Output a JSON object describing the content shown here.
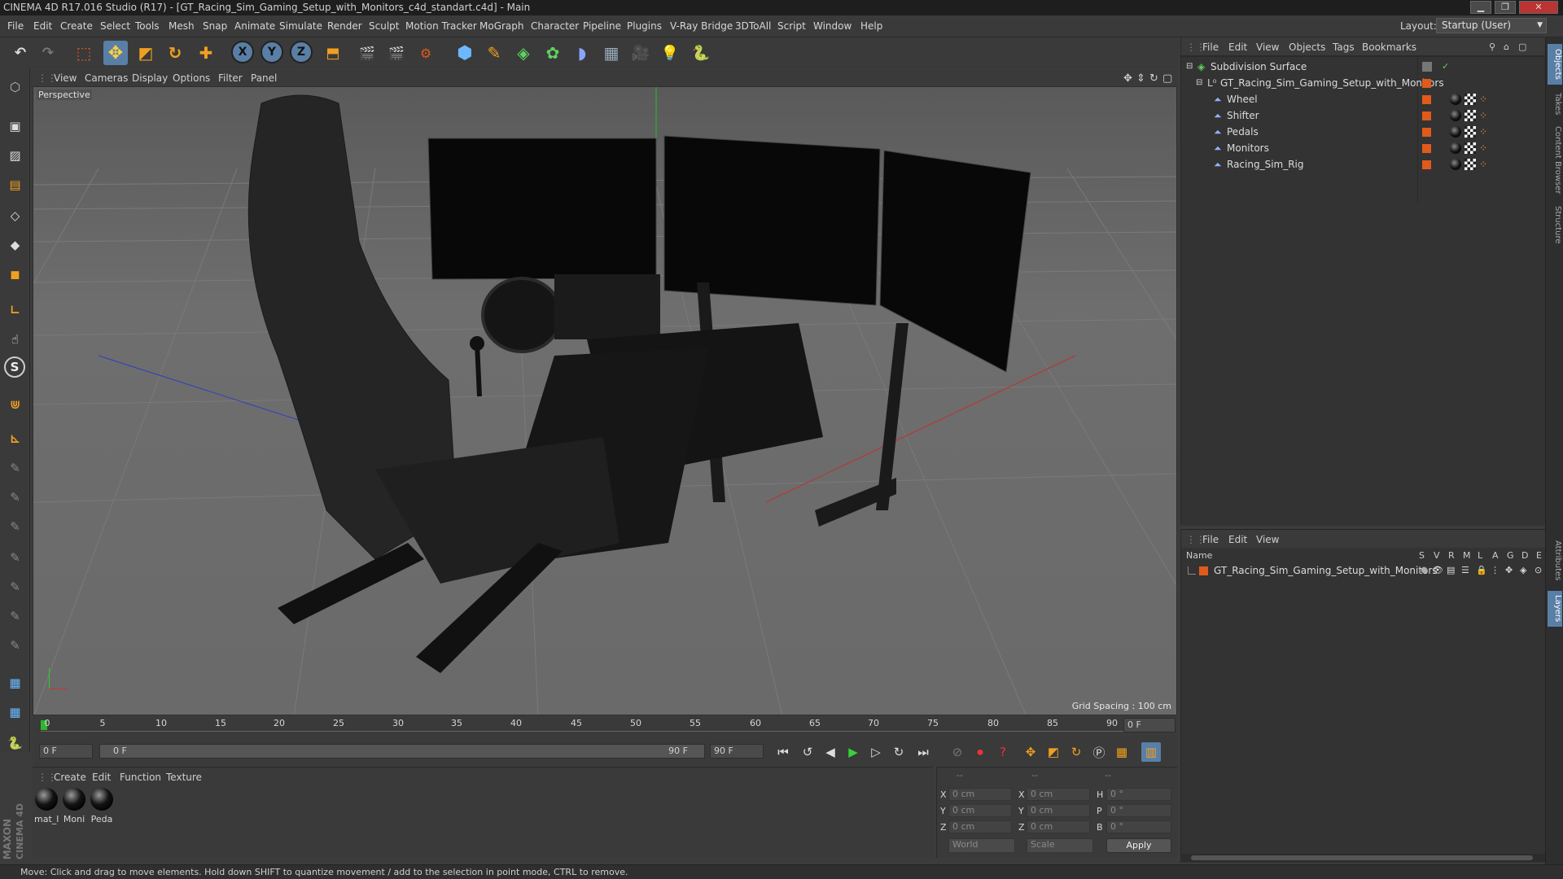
{
  "app_title": "CINEMA 4D R17.016 Studio (R17) - [GT_Racing_Sim_Gaming_Setup_with_Monitors_c4d_standart.c4d] - Main",
  "menu": [
    "File",
    "Edit",
    "Create",
    "Select",
    "Tools",
    "Mesh",
    "Snap",
    "Animate",
    "Simulate",
    "Render",
    "Sculpt",
    "Motion Tracker",
    "MoGraph",
    "Character",
    "Pipeline",
    "Plugins",
    "V-Ray Bridge",
    "3DToAll",
    "Script",
    "Window",
    "Help"
  ],
  "layout": {
    "label": "Layout:",
    "value": "Startup (User)"
  },
  "viewport": {
    "menu": [
      "View",
      "Cameras",
      "Display",
      "Options",
      "Filter",
      "Panel"
    ],
    "label": "Perspective",
    "grid_spacing": "Grid Spacing : 100 cm"
  },
  "timeline": {
    "ticks": [
      "0",
      "5",
      "10",
      "15",
      "20",
      "25",
      "30",
      "35",
      "40",
      "45",
      "50",
      "55",
      "60",
      "65",
      "70",
      "75",
      "80",
      "85",
      "90"
    ],
    "current_frame": "0 F"
  },
  "playback": {
    "start_field": "0 F",
    "range_start": "0 F",
    "range_end": "90 F",
    "end_field": "90 F"
  },
  "materials": {
    "menu": [
      "Create",
      "Edit",
      "Function",
      "Texture"
    ],
    "items": [
      "mat_l",
      "Moni",
      "Peda"
    ]
  },
  "coords": {
    "header": [
      "--",
      "--",
      "--"
    ],
    "rows": [
      {
        "a": "X",
        "av": "0 cm",
        "b": "X",
        "bv": "0 cm",
        "c": "H",
        "cv": "0 °"
      },
      {
        "a": "Y",
        "av": "0 cm",
        "b": "Y",
        "bv": "0 cm",
        "c": "P",
        "cv": "0 °"
      },
      {
        "a": "Z",
        "av": "0 cm",
        "b": "Z",
        "bv": "0 cm",
        "c": "B",
        "cv": "0 °"
      }
    ],
    "mode1": "World",
    "mode2": "Scale",
    "apply": "Apply"
  },
  "objects": {
    "menu": [
      "File",
      "Edit",
      "View",
      "Objects",
      "Tags",
      "Bookmarks"
    ],
    "rows": [
      "Subdivision Surface",
      "GT_Racing_Sim_Gaming_Setup_with_Monitors",
      "Wheel",
      "Shifter",
      "Pedals",
      "Monitors",
      "Racing_Sim_Rig"
    ]
  },
  "layers": {
    "menu": [
      "File",
      "Edit",
      "View"
    ],
    "columns": [
      "Name",
      "S",
      "V",
      "R",
      "M",
      "L",
      "A",
      "G",
      "D",
      "E"
    ],
    "row": "GT_Racing_Sim_Gaming_Setup_with_Monitors"
  },
  "side_tabs": [
    "Objects",
    "Takes",
    "Content Browser",
    "Structure",
    "Attributes",
    "Layers"
  ],
  "status": "Move: Click and drag to move elements. Hold down SHIFT to quantize movement / add to the selection in point mode, CTRL to remove.",
  "brand": [
    "MAXON",
    "CINEMA 4D"
  ],
  "colors": {
    "accent": "#e05a1b",
    "selected_tool": "#5a7fa6"
  }
}
